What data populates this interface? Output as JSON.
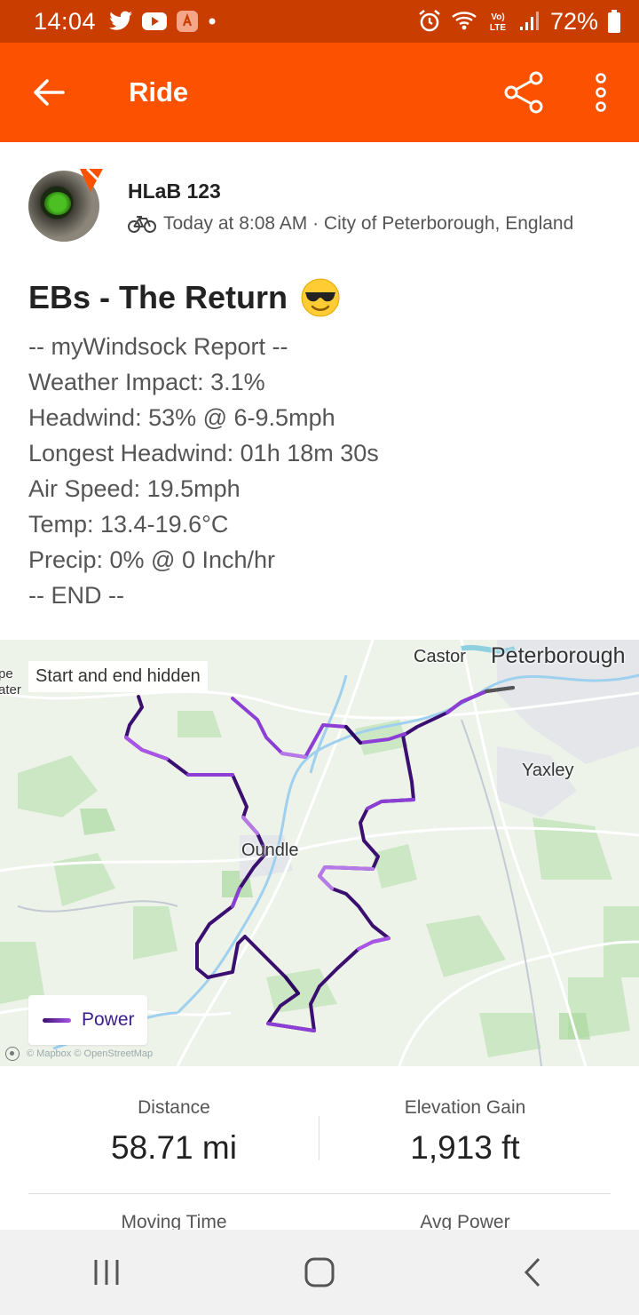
{
  "status_bar": {
    "time": "14:04",
    "battery": "72%",
    "icons": [
      "twitter-icon",
      "youtube-icon",
      "app-icon",
      "dot-icon",
      "alarm-icon",
      "wifi-icon",
      "volte-icon",
      "signal-icon",
      "battery-icon"
    ]
  },
  "app_bar": {
    "title": "Ride",
    "back_icon": "arrow-left-icon",
    "share_icon": "share-icon",
    "more_icon": "more-vertical-icon",
    "color": "#fc5200"
  },
  "athlete": {
    "name": "HLaB 123",
    "meta": "Today at 8:08 AM · City of Peterborough, England",
    "activity_icon": "bike-icon"
  },
  "activity": {
    "title": "EBs - The Return",
    "title_emoji": "sunglasses-emoji",
    "description": [
      "-- myWindsock Report --",
      "Weather Impact: 3.1%",
      "Headwind: 53% @ 6-9.5mph",
      "Longest Headwind: 01h 18m 30s",
      "Air Speed: 19.5mph",
      "Temp: 13.4-19.6°C",
      "Precip: 0% @ 0 Inch/hr",
      "-- END --"
    ]
  },
  "map": {
    "badge": "Start and end hidden",
    "legend_label": "Power",
    "places": {
      "castor": "Castor",
      "peterborough": "Peterborough",
      "yaxley": "Yaxley",
      "oundle": "Oundle",
      "left_edge_1": "pe",
      "left_edge_2": "ater"
    },
    "attribution": "© Mapbox © OpenStreetMap"
  },
  "stats": [
    {
      "label": "Distance",
      "value": "58.71 mi"
    },
    {
      "label": "Elevation Gain",
      "value": "1,913 ft"
    },
    {
      "label": "Moving Time",
      "value": ""
    },
    {
      "label": "Avg Power",
      "value": ""
    }
  ],
  "nav_bar": {
    "icons": [
      "recent-apps-icon",
      "home-icon",
      "back-icon"
    ]
  }
}
